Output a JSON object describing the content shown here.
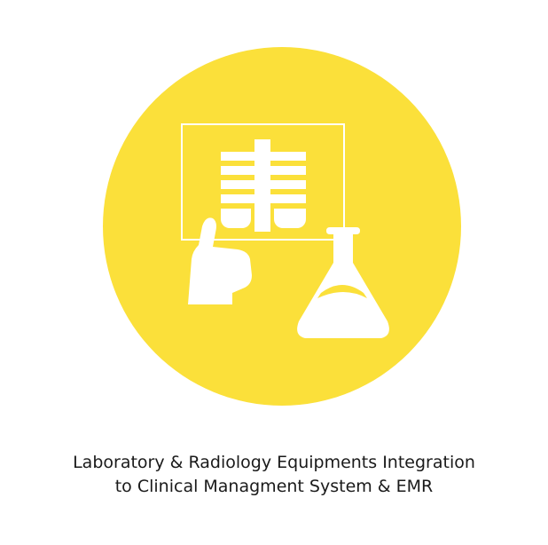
{
  "colors": {
    "circle": "#fbe03a",
    "icon": "#ffffff",
    "text": "#1a1a1a",
    "background": "#ffffff"
  },
  "icons": [
    "xray-film-icon",
    "hand-icon",
    "lab-flask-icon"
  ],
  "caption": {
    "line1": "Laboratory & Radiology Equipments Integration",
    "line2": "to Clinical Managment System & EMR"
  }
}
